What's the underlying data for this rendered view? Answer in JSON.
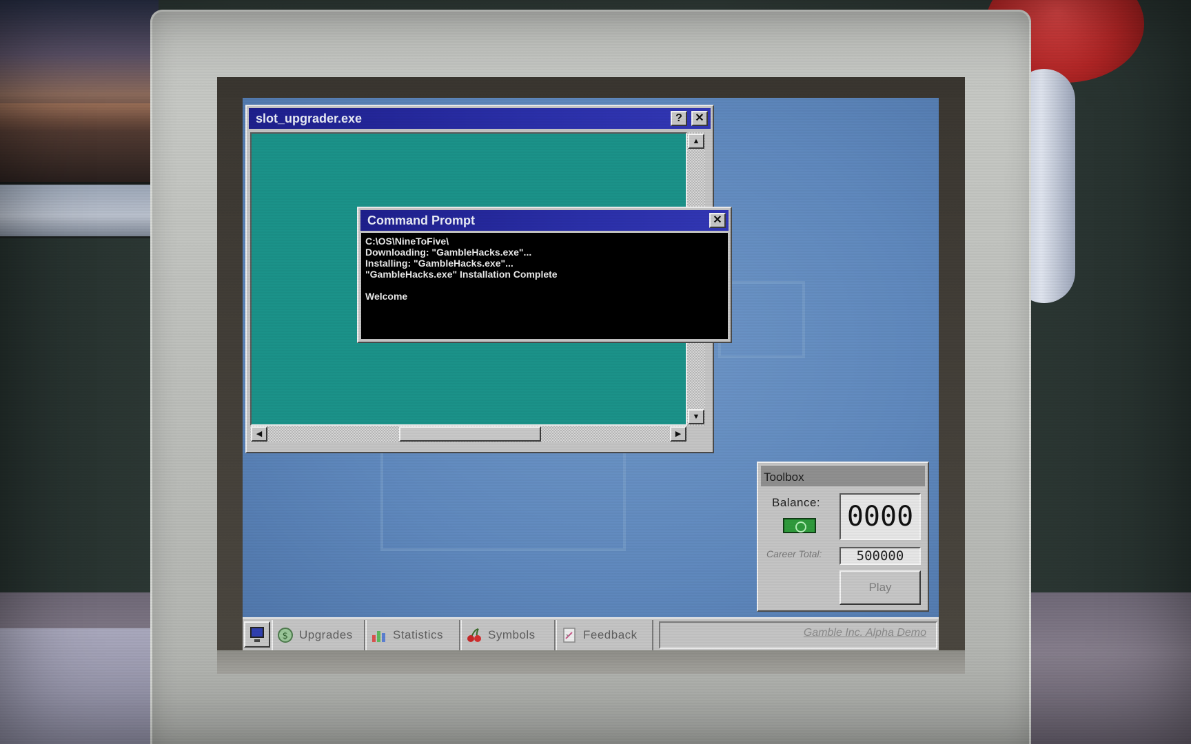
{
  "slot_window": {
    "title": "slot_upgrader.exe",
    "help_label": "?",
    "close_label": "✕",
    "scroll_up": "▲",
    "scroll_down": "▼",
    "scroll_left": "◀",
    "scroll_right": "▶"
  },
  "command_prompt": {
    "title": "Command Prompt",
    "close_label": "✕",
    "lines": [
      "C:\\OS\\NineToFive\\",
      "Downloading: \"GambleHacks.exe\"...",
      "Installing: \"GambleHacks.exe\"...",
      "\"GambleHacks.exe\" Installation Complete",
      "",
      "Welcome"
    ]
  },
  "toolbox": {
    "title": "Toolbox",
    "balance_label": "Balance:",
    "balance_value": "0000",
    "career_label": "Career Total:",
    "career_value": "500000",
    "play_label": "Play"
  },
  "taskbar": {
    "tabs": [
      {
        "label": "Upgrades",
        "icon": "dollar-coin-icon"
      },
      {
        "label": "Statistics",
        "icon": "bar-chart-icon"
      },
      {
        "label": "Symbols",
        "icon": "cherries-icon"
      },
      {
        "label": "Feedback",
        "icon": "document-pencil-icon"
      }
    ],
    "tray_text": "Gamble Inc. Alpha Demo"
  },
  "colors": {
    "titlebar": "#1e1f8c",
    "desktop": "#5f88bd",
    "slot_body": "#1b9289",
    "window_gray": "#c4c4c4"
  }
}
